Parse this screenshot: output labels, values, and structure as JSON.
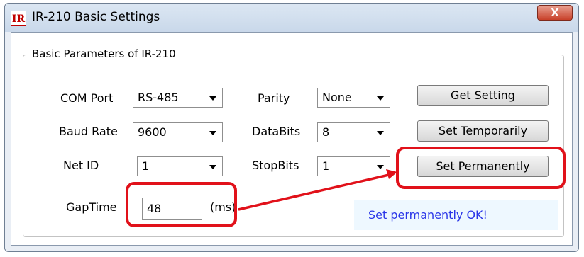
{
  "window": {
    "title": "IR-210 Basic Settings",
    "app_icon_text": "IR",
    "close_label": "X"
  },
  "group": {
    "title": "Basic Parameters of IR-210"
  },
  "fields": {
    "com_port": {
      "label": "COM Port",
      "value": "RS-485"
    },
    "baud_rate": {
      "label": "Baud Rate",
      "value": "9600"
    },
    "net_id": {
      "label": "Net ID",
      "value": "1"
    },
    "parity": {
      "label": "Parity",
      "value": "None"
    },
    "databits": {
      "label": "DataBits",
      "value": "8"
    },
    "stopbits": {
      "label": "StopBits",
      "value": "1"
    },
    "gaptime": {
      "label": "GapTime",
      "value": "48",
      "unit": "(ms)"
    }
  },
  "buttons": {
    "get_setting": "Get Setting",
    "set_temporarily": "Set Temporarily",
    "set_permanently": "Set Permanently"
  },
  "status": {
    "message": "Set permanently OK!"
  },
  "colors": {
    "highlight": "#e1111a",
    "status_text": "#2a36e8"
  }
}
